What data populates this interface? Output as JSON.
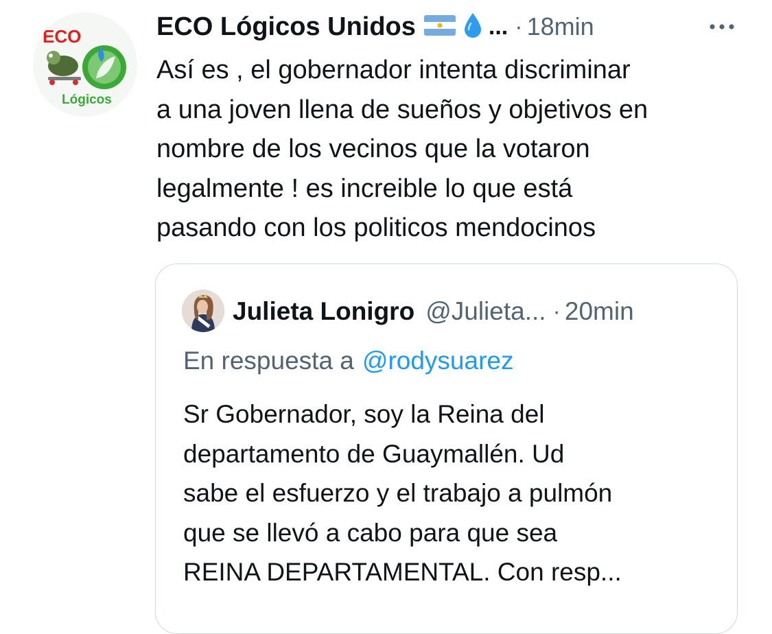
{
  "tweet": {
    "avatar": {
      "icon": "eco-logicos-logo",
      "logo_text_top": "ECO",
      "logo_text_bottom": "Lógicos"
    },
    "author_name": "ECO Lógicos Unidos",
    "name_icons": [
      "argentina-flag-icon",
      "droplet-icon"
    ],
    "name_truncation": "...",
    "separator": "·",
    "timestamp": "18min",
    "more_icon": "more-options-icon",
    "text_lines": [
      "Así es , el gobernador intenta discriminar",
      "a una joven llena de sueños y objetivos en",
      "nombre de los vecinos que la votaron",
      "legalmente ! es increible lo que está",
      "pasando con los politicos mendocinos"
    ]
  },
  "quoted_tweet": {
    "avatar_icon": "user-avatar-photo",
    "author_name": "Julieta Lonigro",
    "handle": "@Julieta...",
    "separator": "·",
    "timestamp": "20min",
    "reply_prefix": "En respuesta a",
    "reply_handle": "@rodysuarez",
    "text_lines": [
      "Sr Gobernador, soy la Reina del",
      "departamento de Guaymallén. Ud",
      "sabe el esfuerzo y el trabajo a pulmón",
      "que se llevó a cabo para que sea",
      "REINA DEPARTAMENTAL.  Con resp..."
    ]
  },
  "colors": {
    "text_primary": "#0f1419",
    "text_secondary": "#536471",
    "link": "#1d9bf0",
    "border": "#cfd9de",
    "logo_red": "#e0201e",
    "logo_green": "#3aa935",
    "flag_blue": "#74acdf"
  }
}
